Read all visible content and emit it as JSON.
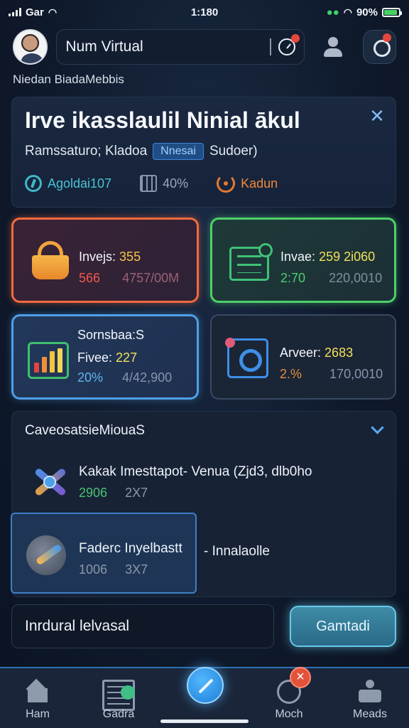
{
  "status_bar": {
    "carrier": "Gar",
    "time": "1:180",
    "battery": "90%",
    "battery_level": 0.9
  },
  "header": {
    "search_text": "Num Virtual"
  },
  "sub_heading": "Niedan BiadaMebbis",
  "hero": {
    "title": "Irve ikasslaulil Ninial ākul",
    "meta_left": "Ramssaturo; Kladoa",
    "tag": "Nnesai",
    "meta_right": "Sudoer)",
    "stats": [
      {
        "icon": "clock-arrow-icon",
        "label": "Agoldai107",
        "color": "#3fb7c9"
      },
      {
        "icon": "grid-icon",
        "label": "40%",
        "color": "#8894a8"
      },
      {
        "icon": "swirl-icon",
        "label": "Kadun",
        "color": "#e47a2f"
      }
    ]
  },
  "tiles": [
    {
      "title": "Invejs:",
      "highlight": "355",
      "highlight_color": "#f6c54a",
      "left": "566",
      "left_color": "#ef5a4a",
      "right": "4757/00M",
      "right_color": "#9b6274",
      "accent": "#f26a3d",
      "icon": "basket-icon"
    },
    {
      "title": "Invae:",
      "highlight": "259 2i060",
      "highlight_color": "#f3e05a",
      "left": "2:70",
      "left_color": "#4bcf6e",
      "right": "220,0010",
      "right_color": "#7c93a0",
      "accent": "#4fd06a",
      "icon": "document-icon"
    },
    {
      "title": "Sornsbaa:S",
      "sub_title": "Fivee:",
      "highlight": "227",
      "highlight_color": "#f3e05a",
      "left": "20%",
      "left_color": "#5fb4ef",
      "right": "4/42,900",
      "right_color": "#8695ad",
      "accent": "#4f9fe8",
      "icon": "bar-chart-icon"
    },
    {
      "title": "Arveer:",
      "highlight": "2683",
      "highlight_color": "#f3e05a",
      "left": "2.%",
      "left_color": "#e88a3b",
      "right": "170,0010",
      "right_color": "#8695ad",
      "accent": "#3a4a63",
      "icon": "gear-target-icon"
    }
  ],
  "section": {
    "title": "CaveosatsieMiouaS",
    "items": [
      {
        "title": "Kakak Imesttapot- Venua (Zjd3,  dlb0ho",
        "meta_left": "2906",
        "meta_left_color": "#49c272",
        "meta_right": "2X7",
        "icon": "tools-icon"
      },
      {
        "title": "Faderc Inyelbastt",
        "extra": "- Innalaolle",
        "meta_left": "1006",
        "meta_right": "3X7",
        "icon": "brush-icon"
      }
    ]
  },
  "input": {
    "value": "Inrdural  lelvasal"
  },
  "action_button": "Gamtadi",
  "bottom_nav": [
    {
      "label": "Ham",
      "icon": "home-icon"
    },
    {
      "label": "Gadra",
      "icon": "gallery-icon"
    },
    {
      "label": "",
      "icon": "compass-pen-icon"
    },
    {
      "label": "Moch",
      "icon": "globe-icon"
    },
    {
      "label": "Meads",
      "icon": "person-icon"
    }
  ],
  "nav_badge": "×",
  "colors": {
    "background": "#0f1a2c",
    "accent_blue": "#3e8fe6",
    "accent_orange": "#f26a3d",
    "accent_green": "#4fd06a"
  }
}
